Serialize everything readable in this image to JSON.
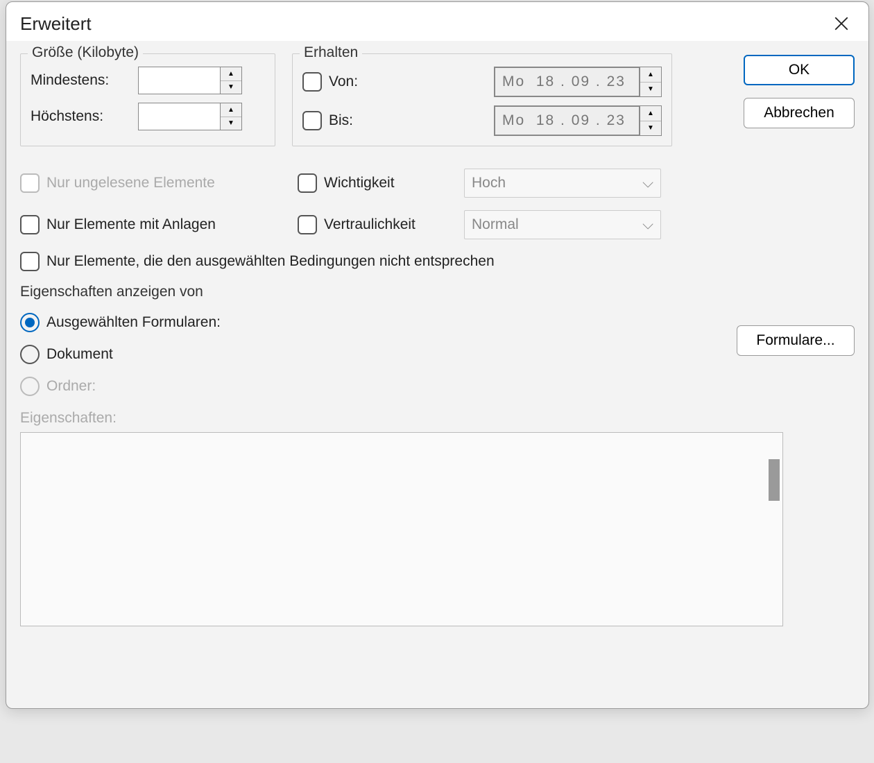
{
  "title": "Erweitert",
  "buttons": {
    "ok": "OK",
    "cancel": "Abbrechen",
    "forms": "Formulare..."
  },
  "size_group": {
    "legend": "Größe (Kilobyte)",
    "min_label": "Mindestens:",
    "max_label": "Höchstens:",
    "min_value": "",
    "max_value": ""
  },
  "receive_group": {
    "legend": "Erhalten",
    "from_label": "Von:",
    "to_label": "Bis:",
    "from_value": "Mo  18 . 09 . 23",
    "to_value": "Mo  18 . 09 . 23"
  },
  "checks": {
    "unread": "Nur ungelesene Elemente",
    "attachments": "Nur Elemente mit Anlagen",
    "not_match": "Nur Elemente, die den ausgewählten Bedingungen nicht entsprechen",
    "importance_label": "Wichtigkeit",
    "confidentiality_label": "Vertraulichkeit",
    "importance_value": "Hoch",
    "confidentiality_value": "Normal"
  },
  "props": {
    "heading": "Eigenschaften anzeigen von",
    "radio_forms": "Ausgewählten Formularen:",
    "radio_doc": "Dokument",
    "radio_folder": "Ordner:",
    "label": "Eigenschaften:"
  }
}
